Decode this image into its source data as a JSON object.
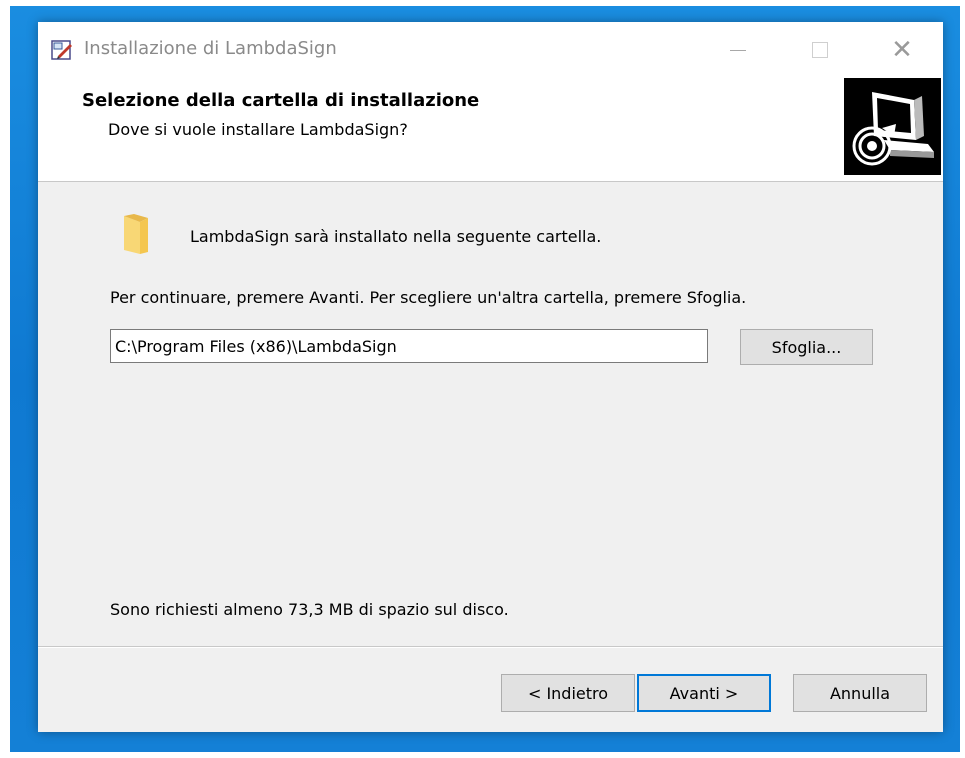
{
  "window": {
    "title": "Installazione di LambdaSign"
  },
  "header": {
    "title": "Selezione della cartella di installazione",
    "subtitle": "Dove si vuole installare LambdaSign?"
  },
  "body": {
    "info_text": "LambdaSign sarà installato nella seguente cartella.",
    "instruction_text": "Per continuare, premere Avanti. Per scegliere un'altra cartella, premere Sfoglia.",
    "path_value": "C:\\Program Files (x86)\\LambdaSign",
    "browse_label": "Sfoglia...",
    "disk_space_text": "Sono richiesti almeno 73,3 MB di spazio sul disco."
  },
  "footer": {
    "back_label": "< Indietro",
    "next_label": "Avanti >",
    "cancel_label": "Annulla"
  },
  "icons": {
    "app": "setup-app-icon",
    "folder": "folder-icon",
    "logo": "installer-computer-icon",
    "minimize": "minimize-icon",
    "maximize": "maximize-icon",
    "close": "close-icon"
  },
  "colors": {
    "desktop_blue": "#0f79d1",
    "window_bg": "#f0f0f0",
    "default_button_border": "#0078d7"
  }
}
